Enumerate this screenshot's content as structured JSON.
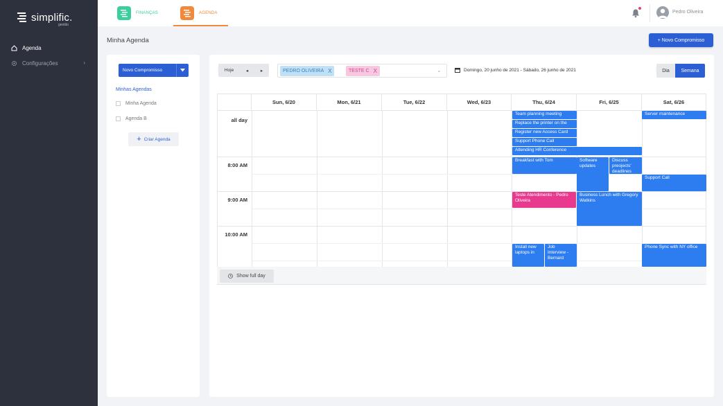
{
  "brand": {
    "name": "simplific.",
    "sub": "gestão"
  },
  "sidebar": {
    "items": [
      {
        "label": "Agenda",
        "icon": "home-icon",
        "active": true
      },
      {
        "label": "Configurações",
        "icon": "gear-icon",
        "active": false
      }
    ]
  },
  "topbar": {
    "apps": [
      {
        "label": "FINANÇAS",
        "color": "#3bcf9c"
      },
      {
        "label": "AGENDA",
        "color": "#f08a3a"
      }
    ],
    "user": "Pedro Oliveira"
  },
  "page": {
    "title": "Minha Agenda",
    "new_button": "+ Novo Compromisso"
  },
  "left_panel": {
    "new_button": "Novo Compromisso",
    "heading": "Minhas Agendas",
    "agendas": [
      "Minha Agenda",
      "Agenda B"
    ],
    "create_button": "Criar Agenda"
  },
  "toolbar": {
    "today": "Hoje",
    "prev": "◂",
    "next": "▸",
    "filters": [
      {
        "label": "PEDRO OLIVEIRA",
        "remove": "X"
      },
      {
        "label": "TESTE C",
        "remove": "X"
      }
    ],
    "date_range": "Domingo, 20 junho de 2021  -  Sábado, 26 junho de 2021",
    "view_day": "Dia",
    "view_week": "Semana"
  },
  "calendar": {
    "days": [
      "Sun, 6/20",
      "Mon, 6/21",
      "Tue, 6/22",
      "Wed, 6/23",
      "Thu, 6/24",
      "Fri, 6/25",
      "Sat, 6/26"
    ],
    "all_day_label": "all day",
    "times": [
      "8:00 AM",
      "9:00 AM",
      "10:00 AM"
    ],
    "events": [
      {
        "title": "Team planning meeting",
        "color": "blue"
      },
      {
        "title": "Replace the printer on the",
        "color": "blue"
      },
      {
        "title": "Register new Access Card",
        "color": "blue"
      },
      {
        "title": "Support Phone Call",
        "color": "blue"
      },
      {
        "title": "Attending HR Conference",
        "color": "blue"
      },
      {
        "title": "Server maintenance",
        "color": "blue"
      },
      {
        "title": "Breakfast with Tom",
        "color": "blue"
      },
      {
        "title": "Software updates",
        "color": "blue"
      },
      {
        "title": "Discuss preojects' deadlines",
        "color": "blue"
      },
      {
        "title": "Support Call",
        "color": "blue"
      },
      {
        "title": "Teste Atendimento - Pedro Oliveira",
        "color": "pink"
      },
      {
        "title": "Business Lunch with Gregory Watkins",
        "color": "blue"
      },
      {
        "title": "Install new laptops in",
        "color": "blue"
      },
      {
        "title": "Job Interview - Bernard",
        "color": "blue"
      },
      {
        "title": "Phone Sync with NY office",
        "color": "blue"
      }
    ],
    "show_full_day": "Show full day"
  },
  "colors": {
    "primary": "#2d5fd4",
    "event_blue": "#2d7cf0",
    "event_pink": "#e8398f",
    "sidebar": "#2c313d"
  }
}
